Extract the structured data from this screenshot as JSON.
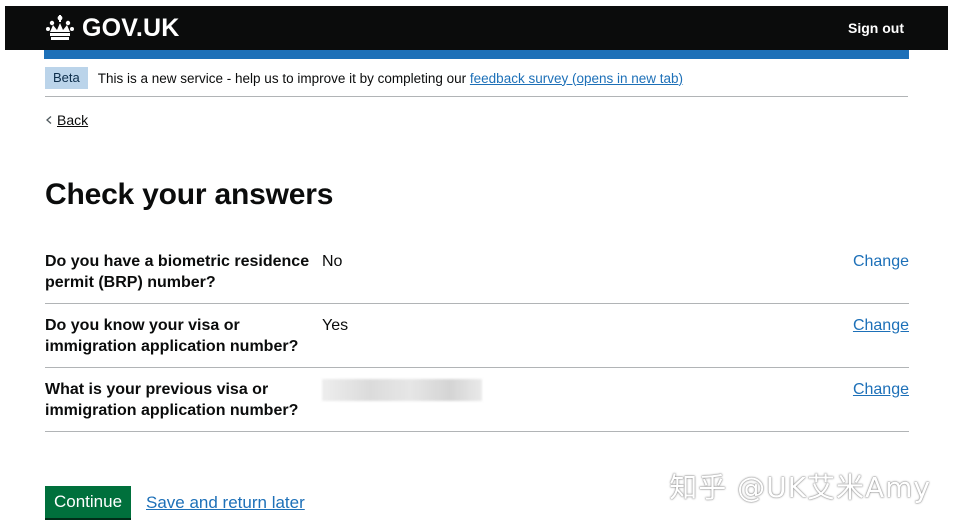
{
  "header": {
    "logo_text": "GOV.UK",
    "sign_out_label": "Sign out"
  },
  "phase_banner": {
    "tag": "Beta",
    "text": "This is a new service - help us to improve it by completing our ",
    "link_text": "feedback survey (opens in new tab)"
  },
  "back_link": "Back",
  "page_title": "Check your answers",
  "summary": {
    "rows": [
      {
        "key": "Do you have a biometric residence permit (BRP) number?",
        "value": "No",
        "action": "Change"
      },
      {
        "key": "Do you know your visa or immigration application number?",
        "value": "Yes",
        "action": "Change"
      },
      {
        "key": "What is your previous visa or immigration application number?",
        "value": "",
        "action": "Change"
      }
    ]
  },
  "buttons": {
    "continue_label": "Continue",
    "save_later_label": "Save and return later"
  },
  "watermark": "知乎 @UK艾米Amy",
  "colors": {
    "header_bg": "#0b0c0c",
    "brand_blue": "#1d70b8",
    "button_green": "#00703c",
    "tag_bg": "#bbd4ea"
  }
}
